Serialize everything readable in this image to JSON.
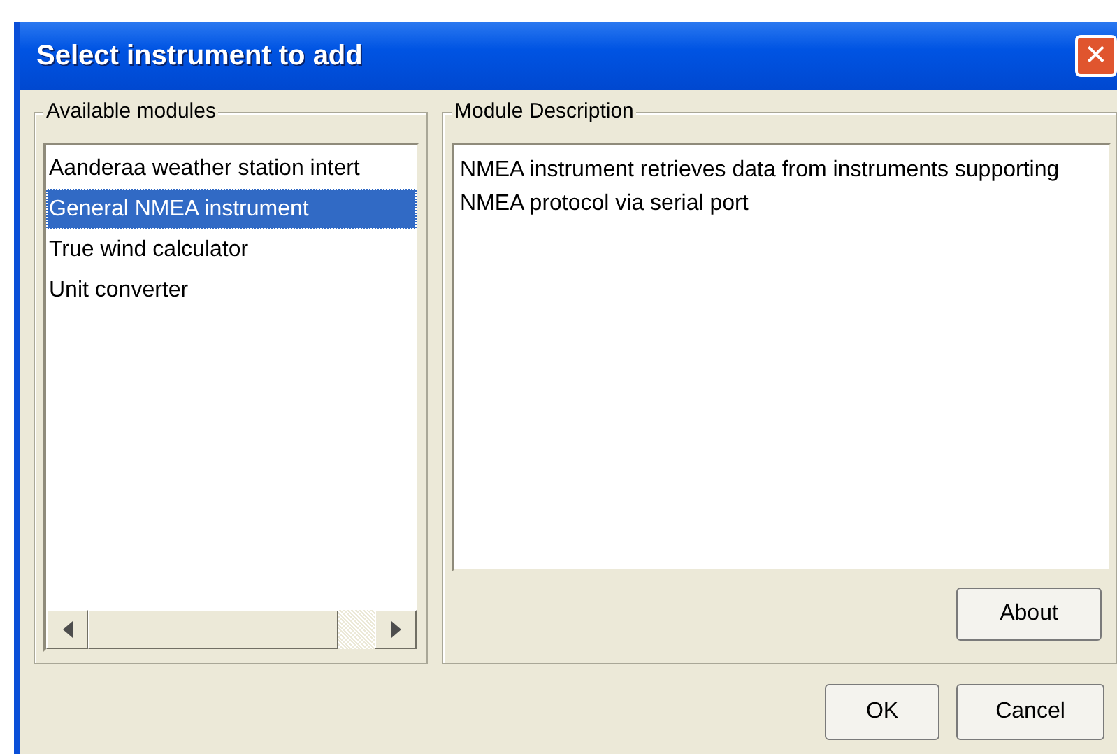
{
  "window": {
    "title": "Select instrument to add",
    "close": "✕"
  },
  "modules": {
    "label": "Available modules",
    "items": [
      {
        "name": "Aanderaa weather station intert",
        "selected": false
      },
      {
        "name": "General NMEA instrument",
        "selected": true
      },
      {
        "name": "True wind calculator",
        "selected": false
      },
      {
        "name": "Unit converter",
        "selected": false
      }
    ]
  },
  "description": {
    "label": "Module Description",
    "text": "NMEA instrument retrieves data from instruments supporting NMEA protocol via serial port"
  },
  "about_button": "About",
  "buttons": [
    "OK",
    "Cancel"
  ]
}
